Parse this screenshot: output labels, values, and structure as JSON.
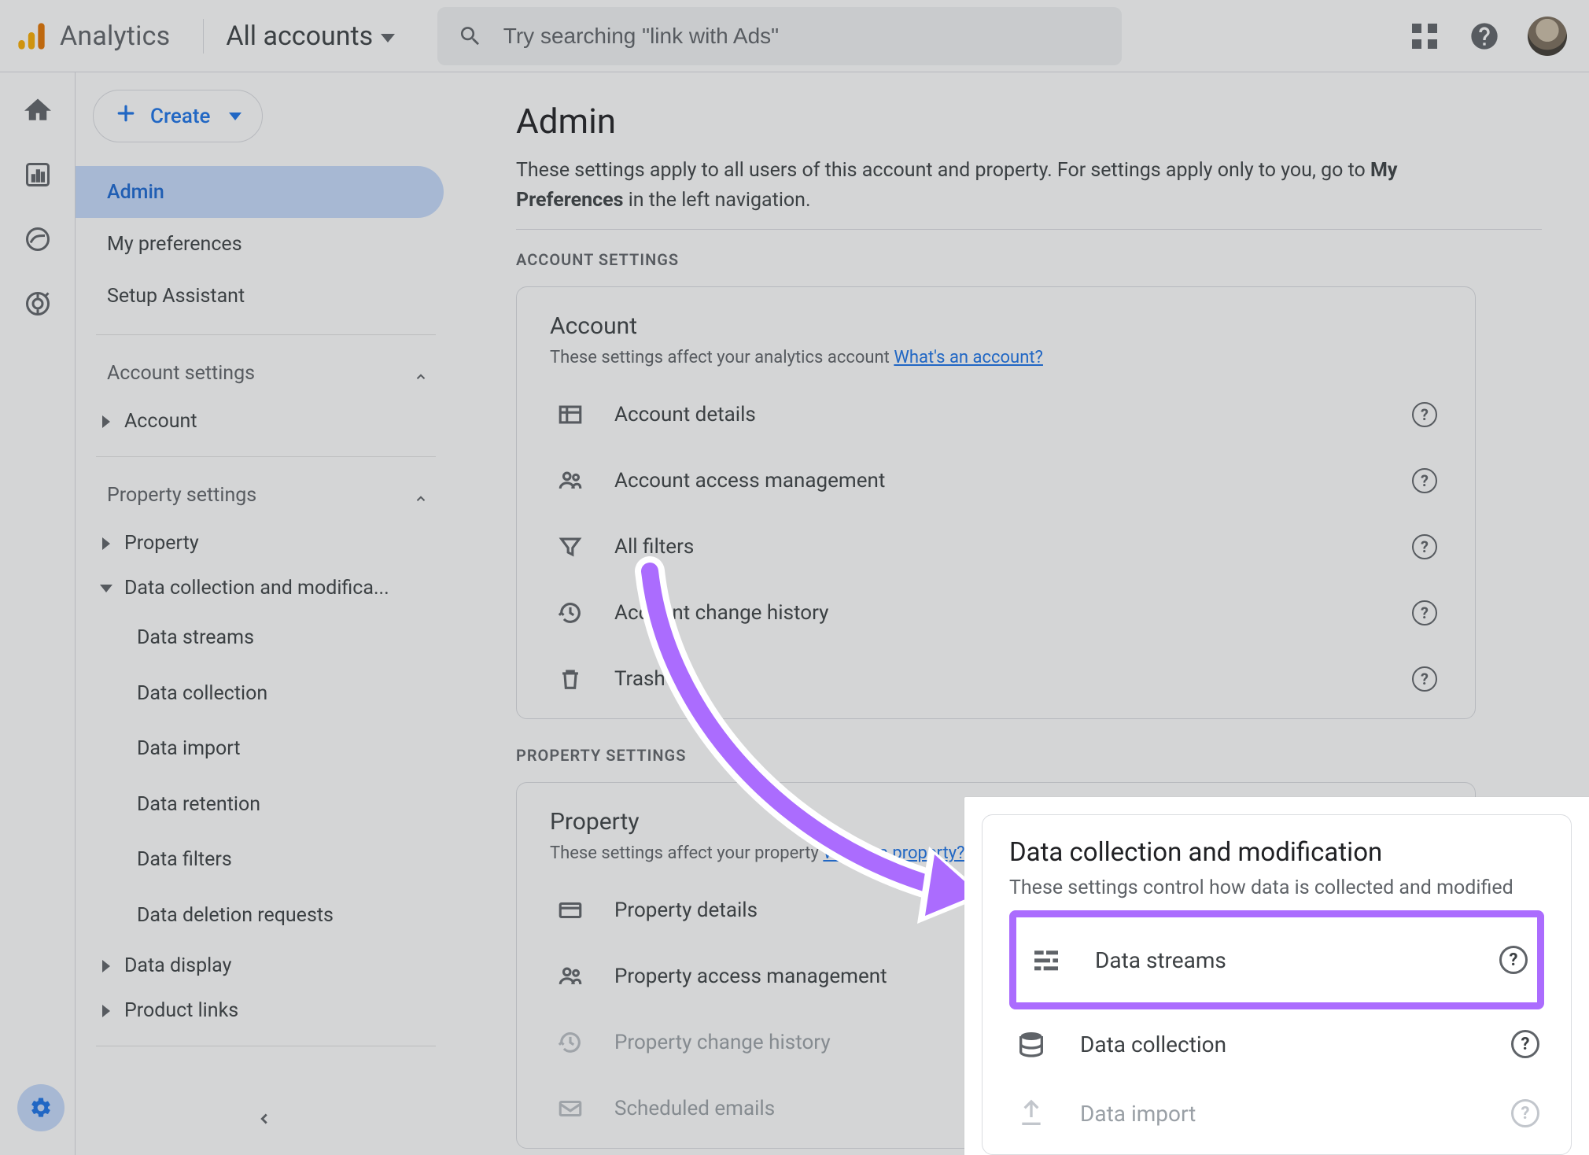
{
  "header": {
    "brand": "Analytics",
    "account_switcher": "All accounts",
    "search_placeholder": "Try searching \"link with Ads\""
  },
  "nav": {
    "create_label": "Create",
    "items": {
      "admin": "Admin",
      "my_prefs": "My preferences",
      "setup_assistant": "Setup Assistant"
    },
    "groups": {
      "account_settings": "Account settings",
      "account": "Account",
      "property_settings": "Property settings",
      "property": "Property",
      "data_coll_mod": "Data collection and modifica...",
      "data_display": "Data display",
      "product_links": "Product links"
    },
    "data_coll_children": {
      "data_streams": "Data streams",
      "data_collection": "Data collection",
      "data_import": "Data import",
      "data_retention": "Data retention",
      "data_filters": "Data filters",
      "data_deletion": "Data deletion requests"
    }
  },
  "main": {
    "title": "Admin",
    "desc_prefix": "These settings apply to all users of this account and property. For settings apply only to you, go to ",
    "desc_bold": "My Preferences",
    "desc_suffix": " in the left navigation.",
    "account_settings_label": "ACCOUNT SETTINGS",
    "account_card": {
      "title": "Account",
      "sub_text": "These settings affect your analytics account ",
      "sub_link": "What's an account?",
      "rows": {
        "details": "Account details",
        "access": "Account access management",
        "filters": "All filters",
        "history": "Account change history",
        "trash": "Trash"
      }
    },
    "property_settings_label": "PROPERTY SETTINGS",
    "property_card": {
      "title": "Property",
      "sub_text": "These settings affect your property ",
      "sub_link": "What's a property?",
      "rows": {
        "details": "Property details",
        "access": "Property access management",
        "history": "Property change history",
        "emails": "Scheduled emails"
      }
    }
  },
  "callout": {
    "title": "Data collection and modification",
    "subtitle": "These settings control how data is collected and modified",
    "rows": {
      "streams": "Data streams",
      "collection": "Data collection",
      "import": "Data import"
    }
  }
}
